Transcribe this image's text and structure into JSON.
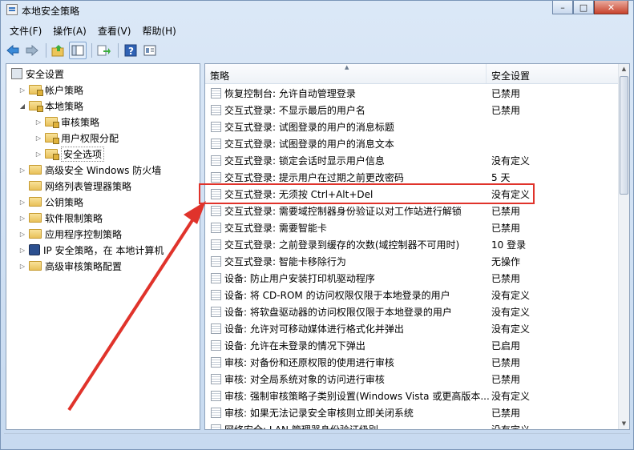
{
  "window": {
    "title": "本地安全策略",
    "btn_min": "–",
    "btn_max": "□",
    "btn_close": "✕"
  },
  "menu": [
    "文件(F)",
    "操作(A)",
    "查看(V)",
    "帮助(H)"
  ],
  "toolbar": [
    "back-arrow-icon",
    "forward-arrow-icon",
    "up-folder-icon",
    "show-tree-icon",
    "export-icon",
    "help-icon",
    "properties-icon"
  ],
  "tree": {
    "root": "安全设置",
    "items": [
      {
        "label": "帐户策略",
        "indent": 1,
        "tri": "▷"
      },
      {
        "label": "本地策略",
        "indent": 1,
        "tri": "◢"
      },
      {
        "label": "审核策略",
        "indent": 2,
        "tri": "▷"
      },
      {
        "label": "用户权限分配",
        "indent": 2,
        "tri": "▷"
      },
      {
        "label": "安全选项",
        "indent": 2,
        "tri": "▷",
        "selected": true
      },
      {
        "label": "高级安全 Windows 防火墙",
        "indent": 1,
        "tri": "▷"
      },
      {
        "label": "网络列表管理器策略",
        "indent": 1,
        "tri": ""
      },
      {
        "label": "公钥策略",
        "indent": 1,
        "tri": "▷"
      },
      {
        "label": "软件限制策略",
        "indent": 1,
        "tri": "▷"
      },
      {
        "label": "应用程序控制策略",
        "indent": 1,
        "tri": "▷"
      },
      {
        "label": "IP 安全策略，在 本地计算机",
        "indent": 1,
        "tri": "▷",
        "ip": true
      },
      {
        "label": "高级审核策略配置",
        "indent": 1,
        "tri": "▷"
      }
    ]
  },
  "list": {
    "col_policy": "策略",
    "col_setting": "安全设置",
    "rows": [
      {
        "name": "恢复控制台: 允许自动管理登录",
        "value": "已禁用"
      },
      {
        "name": "交互式登录: 不显示最后的用户名",
        "value": "已禁用"
      },
      {
        "name": "交互式登录: 试图登录的用户的消息标题",
        "value": ""
      },
      {
        "name": "交互式登录: 试图登录的用户的消息文本",
        "value": ""
      },
      {
        "name": "交互式登录: 锁定会话时显示用户信息",
        "value": "没有定义"
      },
      {
        "name": "交互式登录: 提示用户在过期之前更改密码",
        "value": "5 天"
      },
      {
        "name": "交互式登录: 无须按 Ctrl+Alt+Del",
        "value": "没有定义"
      },
      {
        "name": "交互式登录: 需要域控制器身份验证以对工作站进行解锁",
        "value": "已禁用"
      },
      {
        "name": "交互式登录: 需要智能卡",
        "value": "已禁用"
      },
      {
        "name": "交互式登录: 之前登录到缓存的次数(域控制器不可用时)",
        "value": "10 登录"
      },
      {
        "name": "交互式登录: 智能卡移除行为",
        "value": "无操作"
      },
      {
        "name": "设备: 防止用户安装打印机驱动程序",
        "value": "已禁用"
      },
      {
        "name": "设备: 将 CD-ROM 的访问权限仅限于本地登录的用户",
        "value": "没有定义"
      },
      {
        "name": "设备: 将软盘驱动器的访问权限仅限于本地登录的用户",
        "value": "没有定义"
      },
      {
        "name": "设备: 允许对可移动媒体进行格式化并弹出",
        "value": "没有定义"
      },
      {
        "name": "设备: 允许在未登录的情况下弹出",
        "value": "已启用"
      },
      {
        "name": "审核: 对备份和还原权限的使用进行审核",
        "value": "已禁用"
      },
      {
        "name": "审核: 对全局系统对象的访问进行审核",
        "value": "已禁用"
      },
      {
        "name": "审核: 强制审核策略子类别设置(Windows Vista 或更高版本...",
        "value": "没有定义"
      },
      {
        "name": "审核: 如果无法记录安全审核则立即关闭系统",
        "value": "已禁用"
      },
      {
        "name": "网络安全: LAN 管理器身份验证级别",
        "value": "没有定义"
      }
    ]
  },
  "accent": {
    "highlight": "#e0332b",
    "arrow": "#e0332b"
  }
}
